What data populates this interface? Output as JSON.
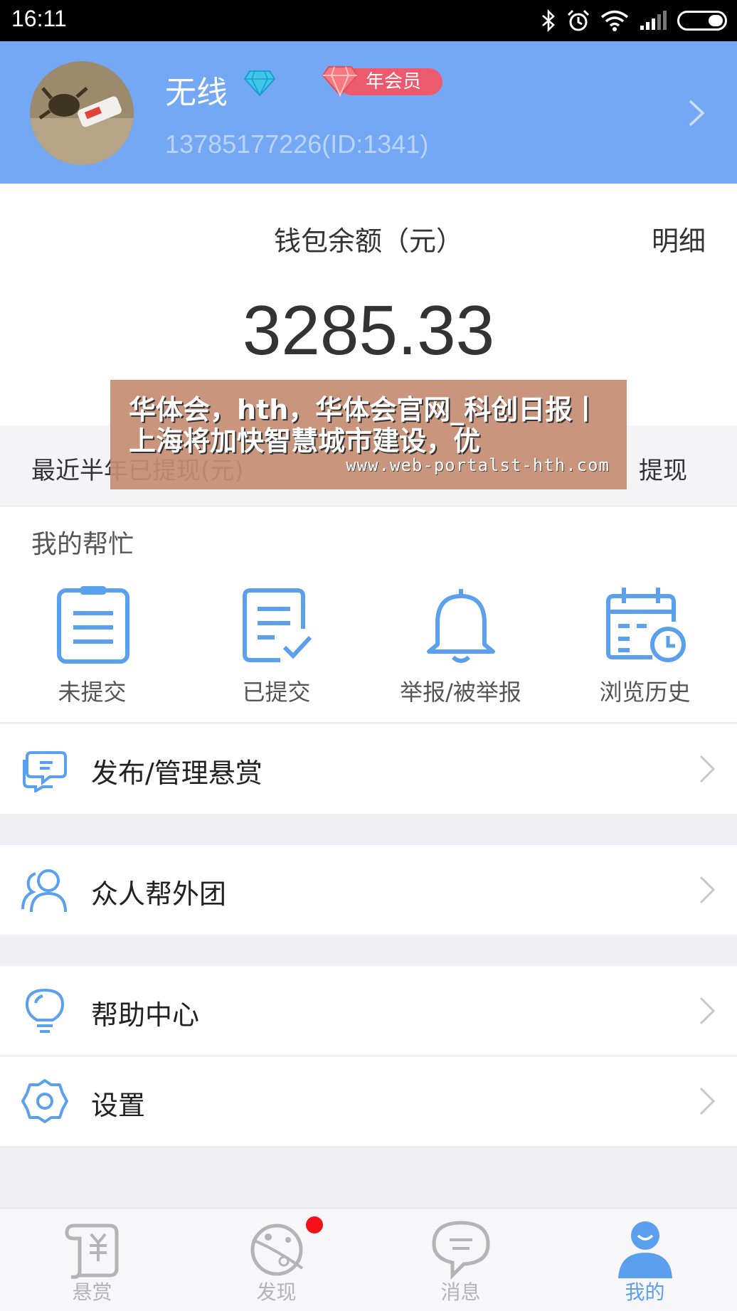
{
  "status_bar": {
    "time": "16:11"
  },
  "profile": {
    "nickname": "无线",
    "vip_badge": "年会员",
    "phone_id": "13785177226(ID:1341)"
  },
  "wallet": {
    "title": "钱包余额（元）",
    "detail_link": "明细",
    "amount": "3285.33"
  },
  "withdraw": {
    "label": "最近半年已提现(元)",
    "button": "提现"
  },
  "help": {
    "title": "我的帮忙",
    "items": [
      {
        "label": "未提交",
        "icon": "clipboard-icon"
      },
      {
        "label": "已提交",
        "icon": "checked-document-icon"
      },
      {
        "label": "举报/被举报",
        "icon": "bell-icon"
      },
      {
        "label": "浏览历史",
        "icon": "calendar-clock-icon"
      }
    ]
  },
  "menu": [
    {
      "label": "发布/管理悬赏",
      "icon": "chat-bubble-icon"
    },
    {
      "label": "众人帮外团",
      "icon": "users-icon"
    },
    {
      "label": "帮助中心",
      "icon": "lightbulb-icon"
    },
    {
      "label": "设置",
      "icon": "settings-icon"
    }
  ],
  "bottom_nav": [
    {
      "label": "悬赏",
      "icon": "reward-scroll-icon",
      "active": false
    },
    {
      "label": "发现",
      "icon": "planet-icon",
      "active": false,
      "badge_dot": true
    },
    {
      "label": "消息",
      "icon": "message-bubble-icon",
      "active": false
    },
    {
      "label": "我的",
      "icon": "user-profile-icon",
      "active": true
    }
  ],
  "overlay": {
    "headline": "华体会，hth，华体会官网_科创日报丨上海将加快智慧城市建设，优",
    "url": "www.web-portalst-hth.com"
  },
  "colors": {
    "header_blue": "#74a8f4",
    "icon_blue": "#5ba0ef",
    "vip_pink": "#ee5a6d",
    "badge_red": "#f5101a"
  }
}
